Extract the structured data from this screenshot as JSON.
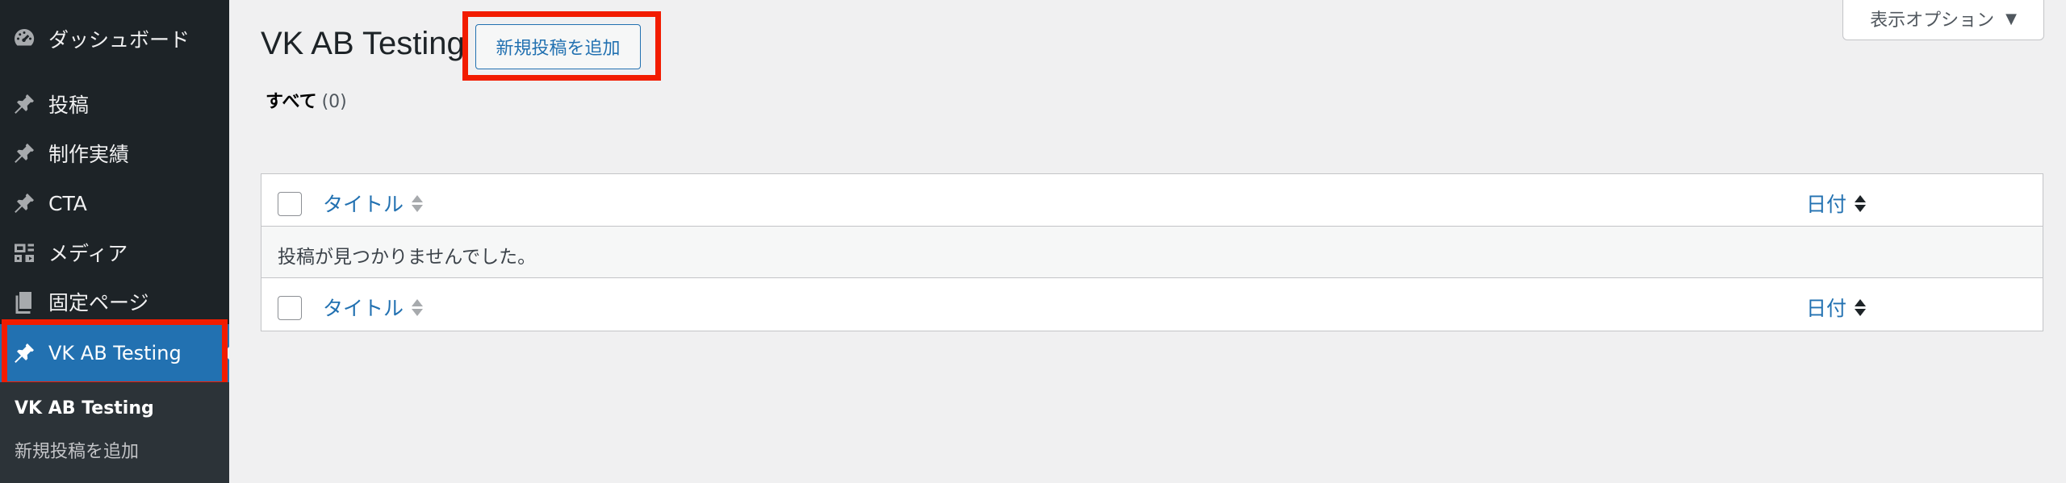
{
  "sidebar": {
    "items": [
      {
        "label": "ダッシュボード",
        "icon": "dashboard-icon"
      },
      {
        "label": "投稿",
        "icon": "pin-icon"
      },
      {
        "label": "制作実績",
        "icon": "pin-icon"
      },
      {
        "label": "CTA",
        "icon": "pin-icon"
      },
      {
        "label": "メディア",
        "icon": "media-icon"
      },
      {
        "label": "固定ページ",
        "icon": "page-icon"
      }
    ],
    "active": {
      "label": "VK AB Testing",
      "icon": "pin-icon"
    },
    "submenu": {
      "current": "VK AB Testing",
      "add_new": "新規投稿を追加"
    }
  },
  "header": {
    "title": "VK AB Testing",
    "add_new_button": "新規投稿を追加",
    "screen_options": "表示オプション"
  },
  "filter": {
    "all_label": "すべて",
    "count": "(0)"
  },
  "table": {
    "columns": {
      "title": "タイトル",
      "date": "日付"
    },
    "empty_message": "投稿が見つかりませんでした。"
  },
  "colors": {
    "sidebar_bg": "#1d2327",
    "active_bg": "#2271b1",
    "highlight_red": "#f21c00",
    "link_blue": "#2271b1"
  }
}
